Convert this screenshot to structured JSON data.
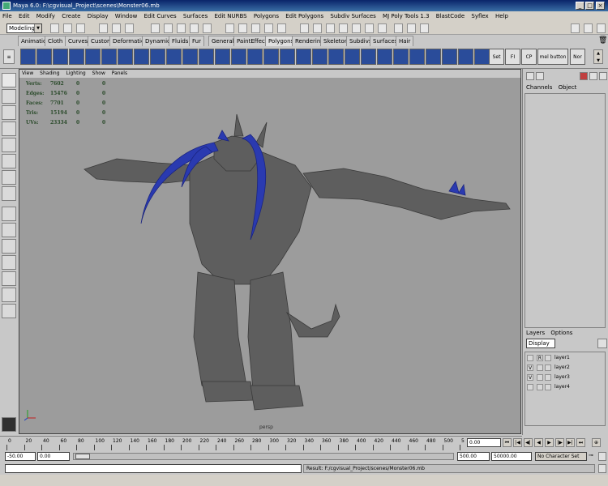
{
  "window": {
    "title": "Maya 6.0: F:\\cgvisual_Project\\scenes\\Monster06.mb"
  },
  "menu": [
    "File",
    "Edit",
    "Modify",
    "Create",
    "Display",
    "Window",
    "Edit Curves",
    "Surfaces",
    "Edit NURBS",
    "Polygons",
    "Edit Polygons",
    "Subdiv Surfaces",
    "MJ Poly Tools 1.3",
    "BlastCode",
    "Syflex",
    "Help"
  ],
  "status": {
    "mode": "Modeling"
  },
  "shelf_tabs": [
    "Animation",
    "Cloth",
    "Curves",
    "Custom",
    "Deformation",
    "Dynamics",
    "Fluids",
    "Fur",
    "General",
    "PaintEffects",
    "Polygons",
    "Rendering",
    "Skeleton",
    "Subdivs",
    "Surfaces",
    "Hair"
  ],
  "shelf_active": "Polygons",
  "shelf_text_icons": [
    "Set",
    "FI",
    "CP",
    "mel button",
    "Nor"
  ],
  "viewport": {
    "menu": [
      "View",
      "Shading",
      "Lighting",
      "Show",
      "Panels"
    ],
    "hud": [
      {
        "label": "Verts:",
        "a": "7602",
        "b": "0",
        "c": "0"
      },
      {
        "label": "Edges:",
        "a": "15476",
        "b": "0",
        "c": "0"
      },
      {
        "label": "Faces:",
        "a": "7701",
        "b": "0",
        "c": "0"
      },
      {
        "label": "Tris:",
        "a": "15194",
        "b": "0",
        "c": "0"
      },
      {
        "label": "UVs:",
        "a": "23334",
        "b": "0",
        "c": "0"
      }
    ],
    "camera": "persp"
  },
  "channels": {
    "menu": [
      "Channels",
      "Object"
    ]
  },
  "layers": {
    "menu": [
      "Layers",
      "Options"
    ],
    "display": "Display",
    "items": [
      {
        "v": "",
        "r": "R",
        "name": "layer1"
      },
      {
        "v": "V",
        "r": "",
        "name": "layer2"
      },
      {
        "v": "V",
        "r": "",
        "name": "layer3"
      },
      {
        "v": "",
        "r": "",
        "name": "layer4"
      }
    ]
  },
  "timeline": {
    "ticks": [
      "0",
      "20",
      "40",
      "60",
      "80",
      "100",
      "120",
      "140",
      "160",
      "180",
      "200",
      "220",
      "240",
      "260",
      "280",
      "300",
      "320",
      "340",
      "360",
      "380",
      "400",
      "420",
      "440",
      "460",
      "480",
      "500",
      "5"
    ],
    "current_frame": "0.00"
  },
  "range": {
    "start_outer": "-50.00",
    "start_inner": "0.00",
    "end_inner": "500.00",
    "end_outer": "50000.00",
    "character": "No Character Set"
  },
  "command": {
    "result": "Result: F:/cgvisual_Project/scenes/Monster06.mb"
  }
}
